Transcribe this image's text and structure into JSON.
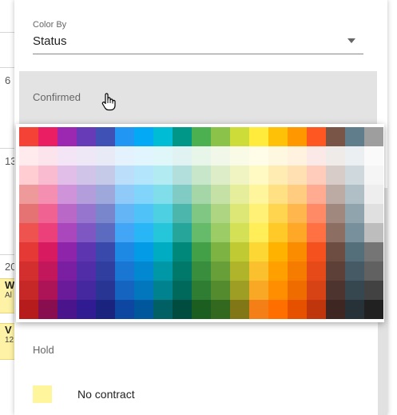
{
  "background_calendar": {
    "day_numbers": [
      "6",
      "13",
      "20"
    ],
    "events": [
      {
        "title": "W",
        "sub": "Al"
      },
      {
        "title": "V",
        "sub": "12"
      }
    ]
  },
  "panel": {
    "color_by_label": "Color By",
    "color_by_value": "Status",
    "rows": [
      {
        "label": "Confirmed"
      },
      {
        "label": "Hold"
      },
      {
        "label": "No contract",
        "swatch": "#fff59d"
      }
    ]
  },
  "color_picker": {
    "columns": [
      "red",
      "pink",
      "purple",
      "deep-purple",
      "indigo",
      "blue",
      "light-blue",
      "cyan",
      "teal",
      "green",
      "light-green",
      "lime",
      "yellow",
      "amber",
      "orange",
      "deep-orange",
      "brown",
      "blue-grey",
      "grey"
    ],
    "rows": [
      [
        "#f44336",
        "#e91e63",
        "#9c27b0",
        "#673ab7",
        "#3f51b5",
        "#2196f3",
        "#03a9f4",
        "#00bcd4",
        "#009688",
        "#4caf50",
        "#8bc34a",
        "#cddc39",
        "#ffeb3b",
        "#ffc107",
        "#ff9800",
        "#ff5722",
        "#795548",
        "#607d8b",
        "#9e9e9e"
      ],
      [
        "#ffebee",
        "#fce4ec",
        "#f3e5f5",
        "#ede7f6",
        "#e8eaf6",
        "#e3f2fd",
        "#e1f5fe",
        "#e0f7fa",
        "#e0f2f1",
        "#e8f5e9",
        "#f1f8e9",
        "#f9fbe7",
        "#fffde7",
        "#fff8e1",
        "#fff3e0",
        "#fbe9e7",
        "#efebe9",
        "#eceff1",
        "#fafafa"
      ],
      [
        "#ffcdd2",
        "#f8bbd0",
        "#e1bee7",
        "#d1c4e9",
        "#c5cae9",
        "#bbdefb",
        "#b3e5fc",
        "#b2ebf2",
        "#b2dfdb",
        "#c8e6c9",
        "#dcedc8",
        "#f0f4c3",
        "#fff9c4",
        "#ffecb3",
        "#ffe0b2",
        "#ffccbc",
        "#d7ccc8",
        "#cfd8dc",
        "#f5f5f5"
      ],
      [
        "#ef9a9a",
        "#f48fb1",
        "#ce93d8",
        "#b39ddb",
        "#9fa8da",
        "#90caf9",
        "#81d4fa",
        "#80deea",
        "#80cbc4",
        "#a5d6a7",
        "#c5e1a5",
        "#e6ee9c",
        "#fff59d",
        "#ffe082",
        "#ffcc80",
        "#ffab91",
        "#bcaaa4",
        "#b0bec5",
        "#eeeeee"
      ],
      [
        "#e57373",
        "#f06292",
        "#ba68c8",
        "#9575cd",
        "#7986cb",
        "#64b5f6",
        "#4fc3f7",
        "#4dd0e1",
        "#4db6ac",
        "#81c784",
        "#aed581",
        "#dce775",
        "#fff176",
        "#ffd54f",
        "#ffb74d",
        "#ff8a65",
        "#a1887f",
        "#90a4ae",
        "#e0e0e0"
      ],
      [
        "#ef5350",
        "#ec407a",
        "#ab47bc",
        "#7e57c2",
        "#5c6bc0",
        "#42a5f5",
        "#29b6f6",
        "#26c6da",
        "#26a69a",
        "#66bb6a",
        "#9ccc65",
        "#d4e157",
        "#ffee58",
        "#ffca28",
        "#ffa726",
        "#ff7043",
        "#8d6e63",
        "#78909c",
        "#bdbdbd"
      ],
      [
        "#e53935",
        "#d81b60",
        "#8e24aa",
        "#5e35b1",
        "#3949ab",
        "#1e88e5",
        "#039be5",
        "#00acc1",
        "#00897b",
        "#43a047",
        "#7cb342",
        "#c0ca33",
        "#fdd835",
        "#ffb300",
        "#fb8c00",
        "#f4511e",
        "#6d4c41",
        "#546e7a",
        "#757575"
      ],
      [
        "#d32f2f",
        "#c2185b",
        "#7b1fa2",
        "#512da8",
        "#303f9f",
        "#1976d2",
        "#0288d1",
        "#0097a7",
        "#00796b",
        "#388e3c",
        "#689f38",
        "#afb42b",
        "#fbc02d",
        "#ffa000",
        "#f57c00",
        "#e64a19",
        "#5d4037",
        "#455a64",
        "#616161"
      ],
      [
        "#c62828",
        "#ad1457",
        "#6a1b9a",
        "#4527a0",
        "#283593",
        "#1565c0",
        "#0277bd",
        "#00838f",
        "#00695c",
        "#2e7d32",
        "#558b2f",
        "#9e9d24",
        "#f9a825",
        "#ff8f00",
        "#ef6c00",
        "#d84315",
        "#4e342e",
        "#37474f",
        "#424242"
      ],
      [
        "#b71c1c",
        "#880e4f",
        "#4a148c",
        "#311b92",
        "#1a237e",
        "#0d47a1",
        "#01579b",
        "#006064",
        "#004d40",
        "#1b5e20",
        "#33691e",
        "#827717",
        "#f57f17",
        "#ff6f00",
        "#e65100",
        "#bf360c",
        "#3e2723",
        "#263238",
        "#212121"
      ]
    ]
  }
}
